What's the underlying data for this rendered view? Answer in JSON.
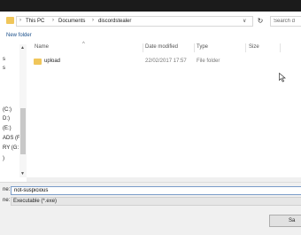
{
  "address": {
    "crumbs": [
      "This PC",
      "Documents",
      "discordstealer"
    ],
    "separator": "›",
    "dropdown_glyph": "∨",
    "refresh_glyph": "↻",
    "search_placeholder": "Search d"
  },
  "command_bar": {
    "new_folder_label": "New folder"
  },
  "nav_pane": {
    "items": [
      "s",
      "s",
      "(C:)",
      "D:)",
      "(E:)",
      "ADS (F",
      "RY (G:",
      ")"
    ]
  },
  "file_list": {
    "columns": {
      "name": "Name",
      "date": "Date modified",
      "type": "Type",
      "size": "Size"
    },
    "sort_glyph": "^",
    "rows": [
      {
        "name": "upload",
        "date": "22/02/2017 17:57",
        "type": "File folder",
        "size": ""
      }
    ]
  },
  "bottom": {
    "file_name_label": "ne:",
    "file_name_value": "not-suspicious",
    "save_type_label": "ne:",
    "save_type_value": "Executable (*.exe)",
    "save_label": "Sa"
  },
  "colors": {
    "folder": "#f0c65a",
    "link": "#1a4f8a",
    "title_bar": "#1b1b1b"
  }
}
